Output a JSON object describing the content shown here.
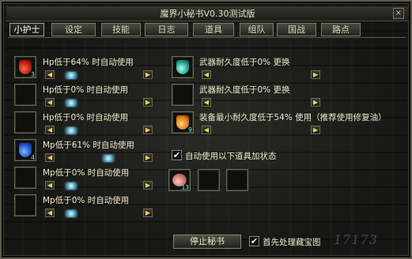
{
  "window": {
    "title": "魔界小秘书V0.30测试版",
    "close_label": "×"
  },
  "tabs": [
    "小护士",
    "设定",
    "技能",
    "日志",
    "道具",
    "组队",
    "国战",
    "路点"
  ],
  "left_rows": [
    {
      "text": "Hp低于64% 时自动使用",
      "count": "3",
      "potion": "red"
    },
    {
      "text": "Hp低于0% 时自动使用",
      "count": "",
      "potion": ""
    },
    {
      "text": "Hp低于0% 时自动使用",
      "count": "",
      "potion": ""
    },
    {
      "text": "Mp低于61% 时自动使用",
      "count": "4",
      "potion": "blue"
    },
    {
      "text": "Mp低于0% 时自动使用",
      "count": "",
      "potion": ""
    },
    {
      "text": "Mp低于0% 时自动使用",
      "count": "",
      "potion": ""
    }
  ],
  "right_rows": [
    {
      "text": "武器耐久度低于0% 更换",
      "potion": "teal",
      "count": ""
    },
    {
      "text": "武器耐久度低于0% 更换",
      "potion": "",
      "count": ""
    },
    {
      "text": "装备最小耐久度低于54% 使用（推荐使用修复油）",
      "potion": "orange",
      "count": "9"
    }
  ],
  "auto_use": {
    "checked": true,
    "label": "自动使用以下道具加状态",
    "slot_count": "13"
  },
  "footer": {
    "stop_button": "停止秘书",
    "treasure_checkbox": {
      "checked": true,
      "label": "首先处理藏宝图"
    }
  },
  "icons": {
    "left_arrow": "◀",
    "right_arrow": "▶",
    "check": "✔"
  }
}
